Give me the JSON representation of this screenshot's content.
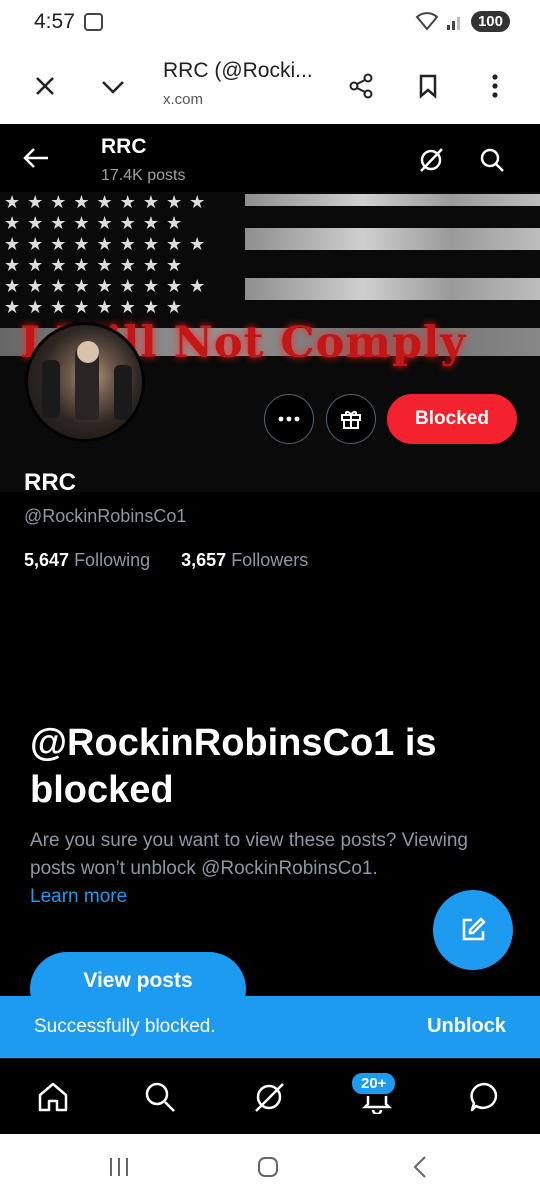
{
  "status_bar": {
    "time": "4:57",
    "battery": "100"
  },
  "browser": {
    "tab_title": "RRC (@Rocki...",
    "url": "x.com"
  },
  "header": {
    "name": "RRC",
    "post_count": "17.4K posts"
  },
  "banner": {
    "text": "I Will Not Comply"
  },
  "profile": {
    "name": "RRC",
    "handle": "@RockinRobinsCo1",
    "following_count": "5,647",
    "following_label": "Following",
    "followers_count": "3,657",
    "followers_label": "Followers",
    "blocked_label": "Blocked"
  },
  "blocked_notice": {
    "heading": "@RockinRobinsCo1 is blocked",
    "body": "Are you sure you want to view these posts? Viewing posts won’t unblock @RockinRobinsCo1.",
    "learn_more": "Learn more",
    "view_posts": "View posts"
  },
  "toast": {
    "message": "Successfully blocked.",
    "action": "Unblock"
  },
  "bottom_nav": {
    "notifications_badge": "20+"
  },
  "colors": {
    "accent": "#1d9bf0",
    "blocked": "#f4212e",
    "background": "#000000"
  },
  "icons": [
    "close-icon",
    "chevron-down-icon",
    "share-icon",
    "bookmark-icon",
    "more-vert-icon",
    "back-arrow-icon",
    "grok-icon",
    "search-icon",
    "more-horizontal-icon",
    "gift-icon",
    "compose-icon",
    "home-icon",
    "bell-icon",
    "messages-icon"
  ]
}
